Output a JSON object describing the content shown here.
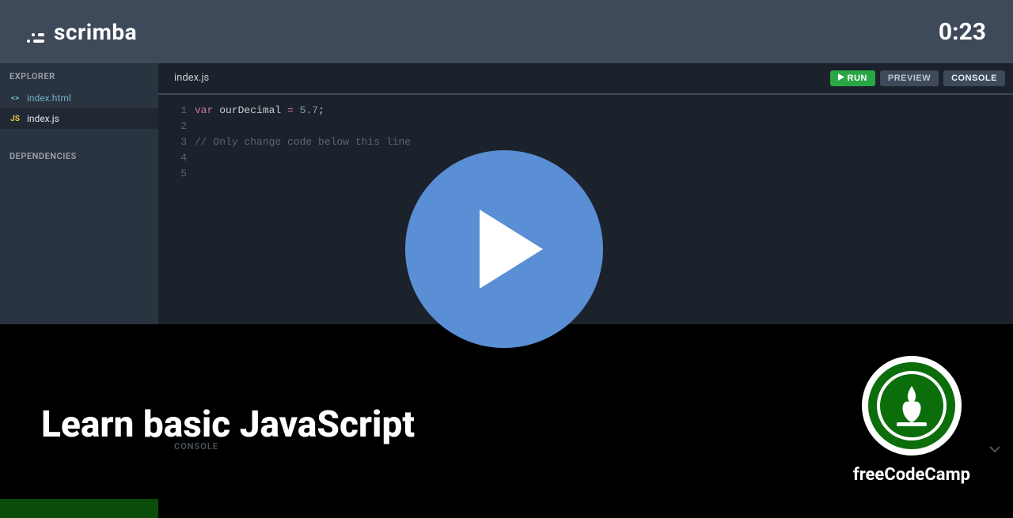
{
  "header": {
    "brand": "scrimba",
    "timer": "0:23"
  },
  "sidebar": {
    "explorer_label": "EXPLORER",
    "dependencies_label": "DEPENDENCIES",
    "files": [
      {
        "name": "index.html",
        "icon": "<>"
      },
      {
        "name": "index.js",
        "icon": "JS"
      }
    ]
  },
  "editor": {
    "active_tab": "index.js",
    "buttons": {
      "run": "RUN",
      "preview": "PREVIEW",
      "console": "CONSOLE"
    },
    "code": {
      "line_numbers": [
        "1",
        "2",
        "3",
        "4",
        "5"
      ],
      "line1": {
        "kw": "var",
        "name": "ourDecimal",
        "op": "=",
        "num": "5.7",
        "punc": ";"
      },
      "line2": "",
      "line3_comment": "// Only change code below this line",
      "line4": "",
      "line5": ""
    }
  },
  "lower": {
    "lesson_title": "Learn basic JavaScript",
    "console_label": "CONSOLE",
    "channel_name": "freeCodeCamp"
  }
}
